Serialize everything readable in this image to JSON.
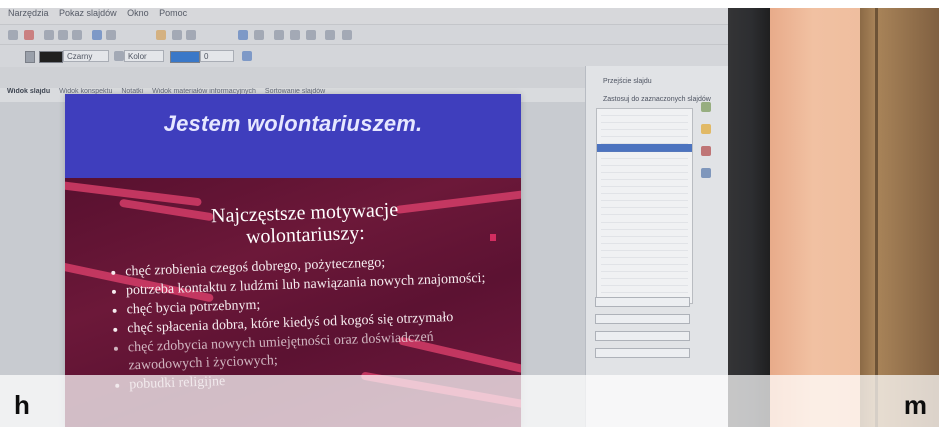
{
  "menu": {
    "items": [
      "Narzędzia",
      "Pokaz slajdów",
      "Okno",
      "Pomoc"
    ]
  },
  "formatting": {
    "line_color": "Czarny",
    "fill_mode": "Kolor",
    "fill_value": "0"
  },
  "tabs": [
    "Widok slajdu",
    "Widok konspektu",
    "Notatki",
    "Widok materiałów informacyjnych",
    "Sortowanie slajdów"
  ],
  "slide": {
    "title": "Jestem wolontariuszem.",
    "subtitle": "Najczęstsze motywacje wolontariuszy:",
    "bullets": [
      "chęć zrobienia czegoś dobrego, pożytecznego;",
      "potrzeba kontaktu z ludźmi lub nawiązania nowych znajomości;",
      "chęć bycia potrzebnym;",
      "chęć spłacenia dobra, które kiedyś od kogoś się otrzymało",
      "chęć zdobycia nowych umiejętności oraz doświadczeń zawodowych i życiowych;",
      "pobudki religijne"
    ]
  },
  "panel": {
    "title": "Przejście slajdu",
    "heading": "Zastosuj do zaznaczonych slajdów"
  },
  "captions": {
    "left": "h",
    "right": "m"
  },
  "colors": {
    "slide_blue": "#3f3ebd",
    "slide_maroon": "#6c1839",
    "wall": "#efbe9f",
    "door": "#a98459"
  }
}
